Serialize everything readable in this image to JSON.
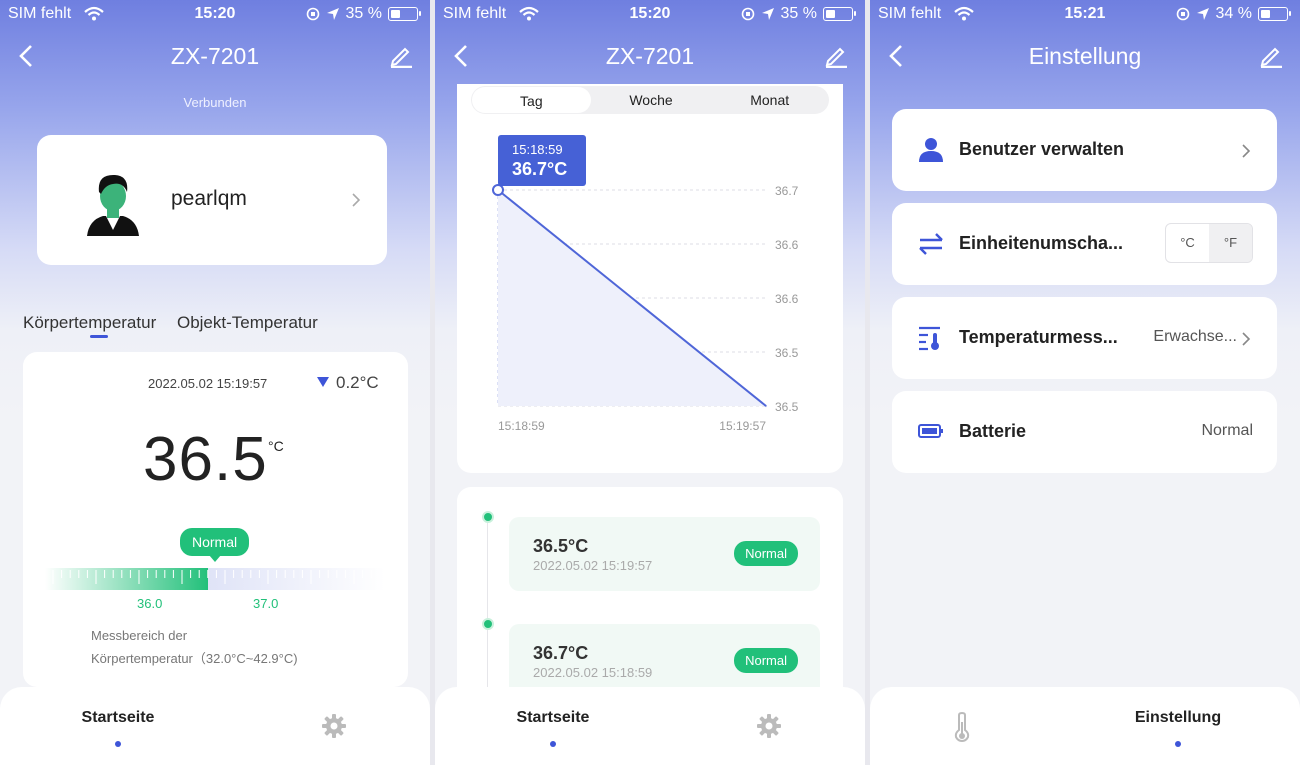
{
  "status": [
    {
      "carrier": "SIM fehlt",
      "time": "15:20",
      "battery": "35 %"
    },
    {
      "carrier": "SIM fehlt",
      "time": "15:20",
      "battery": "35 %"
    },
    {
      "carrier": "SIM fehlt",
      "time": "15:21",
      "battery": "34 %"
    }
  ],
  "home": {
    "title": "ZX-7201",
    "connection": "Verbunden",
    "user_name": "pearlqm",
    "tabs": [
      "Körpertemperatur",
      "Objekt-Temperatur"
    ],
    "timestamp": "2022.05.02 15:19:57",
    "delta": "0.2°C",
    "temperature": "36.5",
    "unit": "°C",
    "status_badge": "Normal",
    "scale_labels": [
      "36.0",
      "37.0"
    ],
    "range_note_1": "Messbereich der",
    "range_note_2": "Körpertemperatur（32.0°C~42.9°C)"
  },
  "history": {
    "title": "ZX-7201",
    "periods": [
      "Tag",
      "Woche",
      "Monat"
    ],
    "tooltip_time": "15:18:59",
    "tooltip_value": "36.7°C",
    "records": [
      {
        "value": "36.5°C",
        "time": "2022.05.02 15:19:57",
        "status": "Normal"
      },
      {
        "value": "36.7°C",
        "time": "2022.05.02 15:18:59",
        "status": "Normal"
      }
    ]
  },
  "chart_data": {
    "type": "line",
    "x": [
      "15:18:59",
      "15:19:57"
    ],
    "values": [
      36.7,
      36.5
    ],
    "ytick_labels": [
      "36.7",
      "36.6",
      "36.6",
      "36.5",
      "36.5"
    ],
    "ylim": [
      36.5,
      36.7
    ],
    "grid": true
  },
  "settings": {
    "title": "Einstellung",
    "rows": [
      {
        "label": "Benutzer verwalten",
        "value": ""
      },
      {
        "label": "Einheitenumscha...",
        "value": ""
      },
      {
        "label": "Temperaturmess...",
        "value": "Erwachse..."
      },
      {
        "label": "Batterie",
        "value": "Normal"
      }
    ],
    "units": [
      "°C",
      "°F"
    ]
  },
  "tabbar": {
    "home": "Startseite",
    "settings": "Einstellung"
  },
  "colors": {
    "accent": "#3e55d8",
    "ok": "#21c07a",
    "header_top": "#6f7fe0"
  }
}
